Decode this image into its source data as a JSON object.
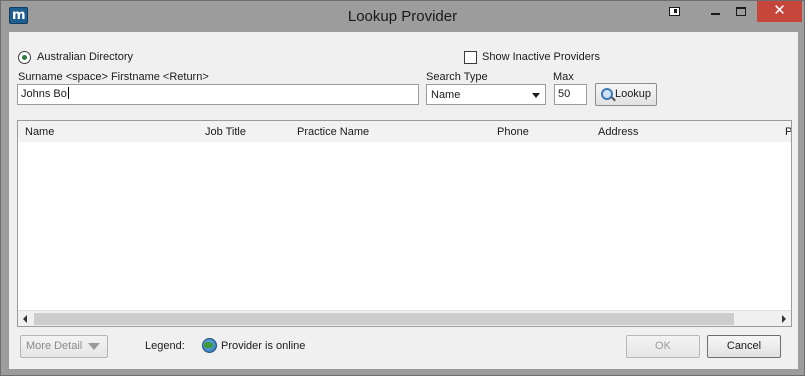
{
  "window": {
    "title": "Lookup Provider",
    "app_icon_letter": "m",
    "close_glyph": "✕"
  },
  "search": {
    "directory_label": "Australian Directory",
    "show_inactive_label": "Show Inactive Providers",
    "hint_label": "Surname <space> Firstname <Return>",
    "surname_value": "Johns Bo",
    "search_type_label": "Search Type",
    "search_type_value": "Name",
    "max_label": "Max",
    "max_value": "50",
    "lookup_label": "Lookup"
  },
  "results": {
    "columns": [
      "Name",
      "Job Title",
      "Practice Name",
      "Phone",
      "Address",
      "P"
    ]
  },
  "footer": {
    "more_detail_label": "More Detail",
    "legend_label": "Legend:",
    "online_label": "Provider is online",
    "ok_label": "OK",
    "cancel_label": "Cancel"
  },
  "icons": [
    "app-logo-icon",
    "restore-icon",
    "minimize-icon",
    "maximize-icon",
    "close-icon",
    "magnifier-icon",
    "chevron-down-icon",
    "globe-online-icon"
  ],
  "colors": {
    "close_button": "#c7463b",
    "radio_selected": "#2d7a3e",
    "app_icon": "#1f5f8f"
  }
}
